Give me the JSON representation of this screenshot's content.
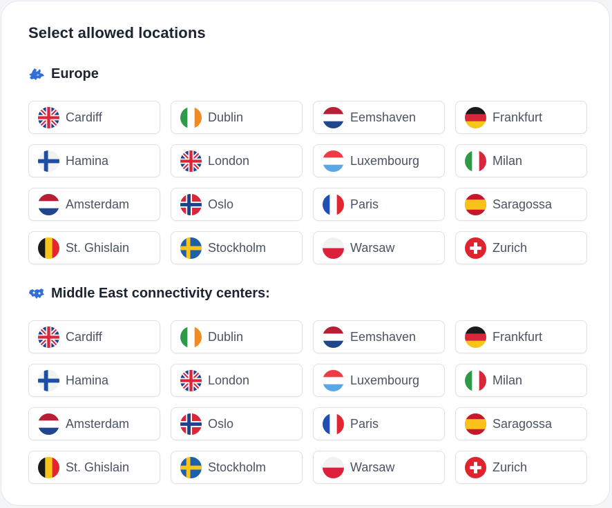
{
  "title": "Select allowed locations",
  "colors": {
    "accent": "#2f6fd6",
    "text_dark": "#1b2430",
    "text_muted": "#4a5361",
    "chip_border": "#dde1e8"
  },
  "sections": [
    {
      "heading": "Europe",
      "icon": "europe-map-icon",
      "locations": [
        {
          "label": "Cardiff",
          "flag": "uk"
        },
        {
          "label": "Dublin",
          "flag": "ie"
        },
        {
          "label": "Eemshaven",
          "flag": "nl"
        },
        {
          "label": "Frankfurt",
          "flag": "de"
        },
        {
          "label": "Hamina",
          "flag": "fi"
        },
        {
          "label": "London",
          "flag": "uk"
        },
        {
          "label": "Luxembourg",
          "flag": "lu"
        },
        {
          "label": "Milan",
          "flag": "it"
        },
        {
          "label": "Amsterdam",
          "flag": "nl"
        },
        {
          "label": "Oslo",
          "flag": "no"
        },
        {
          "label": "Paris",
          "flag": "fr"
        },
        {
          "label": "Saragossa",
          "flag": "es"
        },
        {
          "label": "St. Ghislain",
          "flag": "be"
        },
        {
          "label": "Stockholm",
          "flag": "se"
        },
        {
          "label": "Warsaw",
          "flag": "pl"
        },
        {
          "label": "Zurich",
          "flag": "ch"
        }
      ]
    },
    {
      "heading": "Middle East connectivity centers:",
      "icon": "middle-east-map-icon",
      "locations": [
        {
          "label": "Cardiff",
          "flag": "uk"
        },
        {
          "label": "Dublin",
          "flag": "ie"
        },
        {
          "label": "Eemshaven",
          "flag": "nl"
        },
        {
          "label": "Frankfurt",
          "flag": "de"
        },
        {
          "label": "Hamina",
          "flag": "fi"
        },
        {
          "label": "London",
          "flag": "uk"
        },
        {
          "label": "Luxembourg",
          "flag": "lu"
        },
        {
          "label": "Milan",
          "flag": "it"
        },
        {
          "label": "Amsterdam",
          "flag": "nl"
        },
        {
          "label": "Oslo",
          "flag": "no"
        },
        {
          "label": "Paris",
          "flag": "fr"
        },
        {
          "label": "Saragossa",
          "flag": "es"
        },
        {
          "label": "St. Ghislain",
          "flag": "be"
        },
        {
          "label": "Stockholm",
          "flag": "se"
        },
        {
          "label": "Warsaw",
          "flag": "pl"
        },
        {
          "label": "Zurich",
          "flag": "ch"
        }
      ]
    }
  ]
}
